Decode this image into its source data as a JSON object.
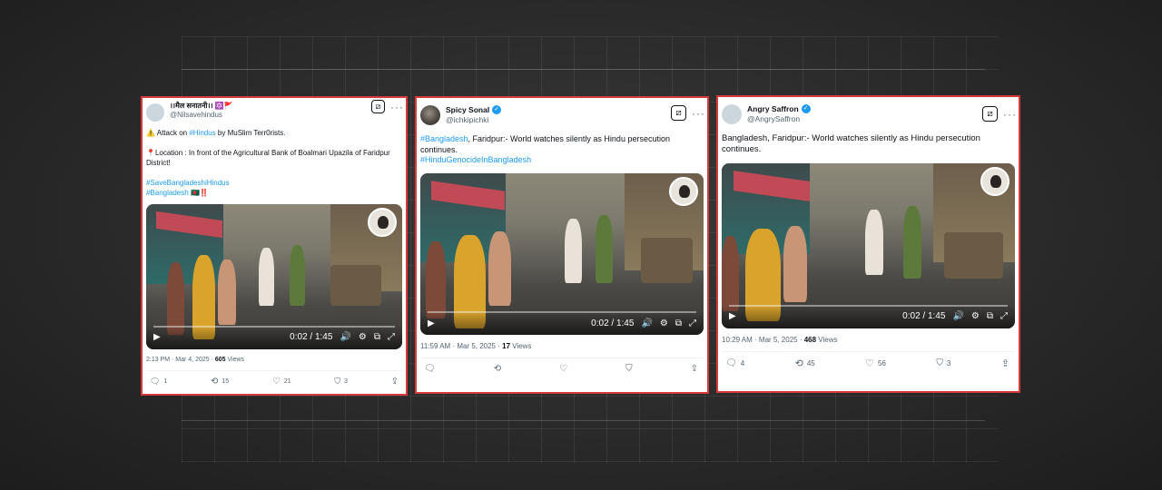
{
  "posts": [
    {
      "display_name": "।।मैल सनातनी।। 🔯🚩",
      "handle": "@Nilsavehindus",
      "text_line1_warn": "⚠️",
      "text_line1_a": "Attack on ",
      "text_line1_tag": "#Hindus",
      "text_line1_b": " by MuSlim Terr0rists.",
      "location": "📍Location : In front of the Agricultural Bank of Boalmari Upazila of Faridpur District!",
      "tag1": "#SaveBangladeshiHindus",
      "tag2": "#Bangladesh",
      "tag2_suffix": " 🇧🇩‼️",
      "video_time": "0:02 / 1:45",
      "timestamp": "2:13 PM · Mar 4, 2025 · ",
      "views_count": "605",
      "views_label": " Views",
      "replies": "1",
      "reposts": "15",
      "likes": "21",
      "bookmarks": "3"
    },
    {
      "display_name": "Spicy Sonal",
      "handle": "@ichkipichki",
      "text_tag": "#Bangladesh",
      "text_body": ", Faridpur:- World watches silently as Hindu persecution continues.",
      "tag2": "#HinduGenocideInBangladesh",
      "video_time": "0:02 / 1:45",
      "timestamp": "11:59 AM · Mar 5, 2025 · ",
      "views_count": "17",
      "views_label": " Views"
    },
    {
      "display_name": "Angry Saffron",
      "handle": "@AngrySaffron",
      "text_body": "Bangladesh, Faridpur:- World watches silently as Hindu persecution continues.",
      "video_time": "0:02 / 1:45",
      "timestamp": "10:29 AM · Mar 5, 2025 · ",
      "views_count": "468",
      "views_label": " Views",
      "replies": "4",
      "reposts": "45",
      "likes": "56",
      "bookmarks": "3"
    }
  ],
  "icons": {
    "dots": "···",
    "reply": "🗨",
    "repost": "⟲",
    "like": "♡",
    "bookmark": "⛉",
    "share": "⇪",
    "play": "▶",
    "volume": "🔊",
    "settings": "⚙",
    "popout": "⧉",
    "fullscreen": "⤢",
    "grok": "⧄"
  },
  "colors": {
    "card_border": "#d63a3a",
    "hashtag": "#1d9bf0",
    "verified": "#1d9bf0"
  }
}
